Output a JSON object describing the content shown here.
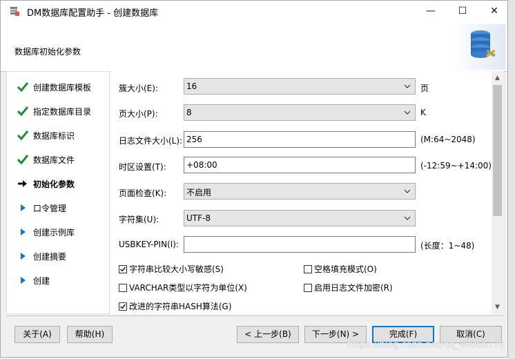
{
  "window": {
    "title": "DM数据库配置助手 - 创建数据库",
    "minimize": "—",
    "maximize": "☐",
    "close": "✕"
  },
  "header": {
    "title": "数据库初始化参数"
  },
  "nav": [
    {
      "label": "创建数据库模板",
      "state": "done"
    },
    {
      "label": "指定数据库目录",
      "state": "done"
    },
    {
      "label": "数据库标识",
      "state": "done"
    },
    {
      "label": "数据库文件",
      "state": "done"
    },
    {
      "label": "初始化参数",
      "state": "current"
    },
    {
      "label": "口令管理",
      "state": "todo"
    },
    {
      "label": "创建示例库",
      "state": "todo"
    },
    {
      "label": "创建摘要",
      "state": "todo"
    },
    {
      "label": "创建",
      "state": "todo"
    }
  ],
  "form": {
    "extent_size": {
      "label": "簇大小(E):",
      "value": "16",
      "unit": "页"
    },
    "page_size": {
      "label": "页大小(P):",
      "value": "8",
      "unit": "K"
    },
    "log_size": {
      "label": "日志文件大小(L):",
      "value": "256",
      "unit": "(M:64~2048)"
    },
    "time_zone": {
      "label": "时区设置(T):",
      "value": "+08:00",
      "unit": "(-12:59~+14:00)"
    },
    "page_check": {
      "label": "页面检查(K):",
      "value": "不启用"
    },
    "charset": {
      "label": "字符集(U):",
      "value": "UTF-8"
    },
    "usbkey_pin": {
      "label": "USBKEY-PIN(I):",
      "value": "",
      "unit": "(长度：1~48)"
    },
    "checkboxes": [
      {
        "label": "字符串比较大小写敏感(S)",
        "checked": true
      },
      {
        "label": "空格填充模式(O)",
        "checked": false
      },
      {
        "label": "VARCHAR类型以字符为单位(X)",
        "checked": false
      },
      {
        "label": "启用日志文件加密(R)",
        "checked": false
      },
      {
        "label": "改进的字符串HASH算法(G)",
        "checked": true
      }
    ]
  },
  "buttons": {
    "about": "关于(A)",
    "help": "帮助(H)",
    "prev": "< 上一步(B)",
    "next": "下一步(N) >",
    "finish": "完成(F)",
    "cancel": "取消(C)"
  },
  "watermark": "https://blog.csdn.net/qq_40066776",
  "colors": {
    "check_green": "#1e8c2e",
    "arrow_blue": "#1673c8",
    "default_button_border": "#0078d7"
  }
}
